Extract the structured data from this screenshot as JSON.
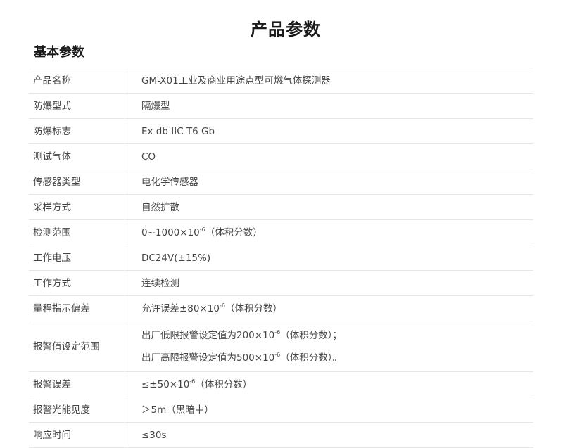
{
  "page": {
    "title": "产品参数",
    "section_title": "基本参数"
  },
  "params": [
    {
      "label": "产品名称",
      "value": "GM-X01工业及商业用途点型可燃气体探测器"
    },
    {
      "label": "防爆型式",
      "value": "隔爆型"
    },
    {
      "label": "防爆标志",
      "value": "Ex db IIC T6 Gb"
    },
    {
      "label": "测试气体",
      "value": "CO"
    },
    {
      "label": "传感器类型",
      "value": "电化学传感器"
    },
    {
      "label": "采样方式",
      "value": "自然扩散"
    },
    {
      "label": "检测范围",
      "value_pre": "0~1000×10",
      "value_exp": "-6",
      "value_post": "（体积分数）"
    },
    {
      "label": "工作电压",
      "value": "DC24V(±15%)"
    },
    {
      "label": "工作方式",
      "value": "连续检测"
    },
    {
      "label": "量程指示偏差",
      "value_pre": "允许误差±80×10",
      "value_exp": "-6",
      "value_post": "（体积分数）"
    },
    {
      "label": "报警值设定范围",
      "line1_pre": "出厂低限报警设定值为200×10",
      "line1_exp": "-6",
      "line1_post": "（体积分数）；",
      "line2_pre": "出厂高限报警设定值为500×10",
      "line2_exp": "-6",
      "line2_post": "（体积分数）。"
    },
    {
      "label": "报警误差",
      "value_pre": "≤±50×10",
      "value_exp": "-6",
      "value_post": "（体积分数）"
    },
    {
      "label": "报警光能见度",
      "value": "＞5m（黑暗中）"
    },
    {
      "label": "响应时间",
      "value": "≤30s"
    }
  ]
}
